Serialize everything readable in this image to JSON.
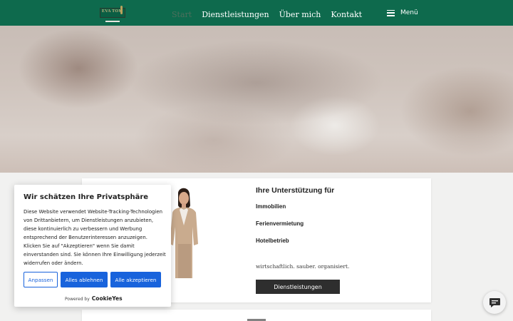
{
  "logo": {
    "text": "EVA TOM"
  },
  "nav": [
    {
      "label": "Start",
      "active": true
    },
    {
      "label": "Dienstleistungen",
      "active": false
    },
    {
      "label": "Über mich",
      "active": false
    },
    {
      "label": "Kontakt",
      "active": false
    }
  ],
  "menu": {
    "label": "Menü",
    "icon": "hamburger-icon"
  },
  "card": {
    "title": "Ihre Unterstützung für",
    "items": [
      "Immobilien",
      "Ferienvermietung",
      "Hotelbetrieb"
    ],
    "tagline": "wirtschaftlich. sauber. organisiert.",
    "button": "Dienstleistungen"
  },
  "cookie": {
    "title": "Wir schätzen Ihre Privatsphäre",
    "body": "Diese Website verwendet Website-Tracking-Technologien von Drittanbietern, um Dienstleistungen anzubieten, diese kontinuierlich zu verbessern und Werbung entsprechend der Benutzerinteressen anzuzeigen. Klicken Sie auf \"Akzeptieren\" wenn Sie damit einverstanden sind. Sie können Ihre Einwilligung jederzeit widerrufen oder ändern.",
    "customize": "Anpassen",
    "reject": "Alles ablehnen",
    "accept": "Alle akzeptieren",
    "powered_by": "Powered by",
    "brand": "CookieYes"
  },
  "chat": {
    "icon": "chat-bubble-icon"
  },
  "colors": {
    "header": "#0e6a4d",
    "cookie_accent": "#1863dc",
    "button_dark": "#2e2e2e"
  }
}
